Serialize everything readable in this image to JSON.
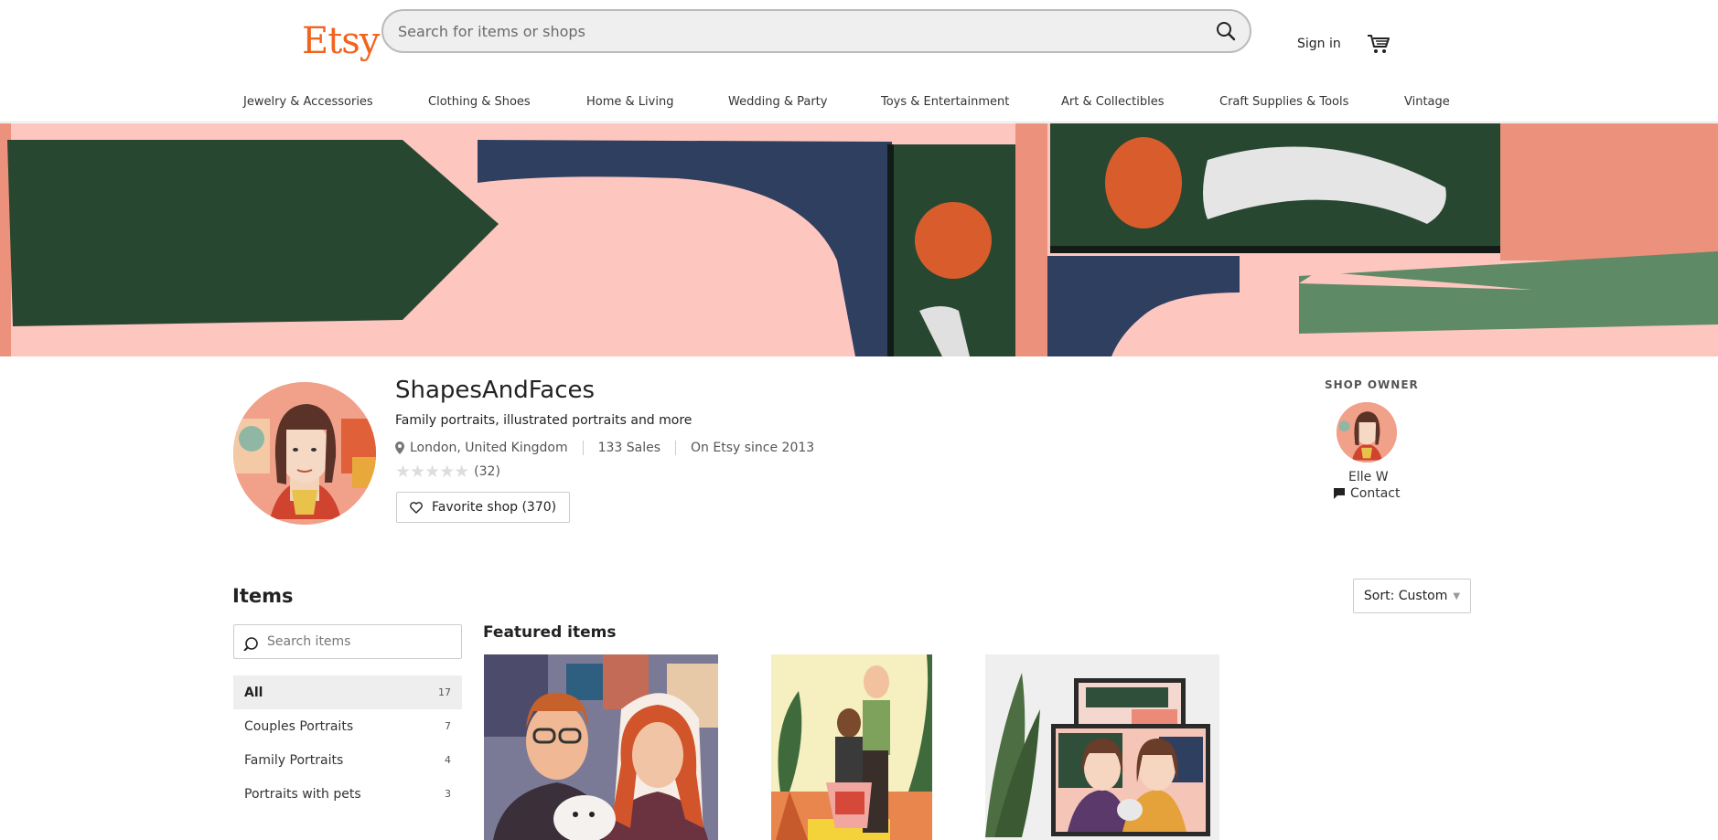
{
  "header": {
    "logo": "Etsy",
    "search_placeholder": "Search for items or shops",
    "signin_label": "Sign in",
    "categories": [
      "Jewelry & Accessories",
      "Clothing & Shoes",
      "Home & Living",
      "Wedding & Party",
      "Toys & Entertainment",
      "Art & Collectibles",
      "Craft Supplies & Tools",
      "Vintage"
    ]
  },
  "shop": {
    "name": "ShapesAndFaces",
    "tagline": "Family portraits, illustrated portraits and more",
    "location": "London, United Kingdom",
    "sales": "133 Sales",
    "since": "On Etsy since 2013",
    "stars": "★★★★★",
    "review_count": "(32)",
    "favorite_label": "Favorite shop (370)"
  },
  "owner": {
    "label": "SHOP OWNER",
    "name": "Elle W",
    "contact_label": "Contact"
  },
  "items": {
    "title": "Items",
    "sort_label": "Sort: Custom",
    "search_placeholder": "Search items",
    "sections": [
      {
        "label": "All",
        "count": "17"
      },
      {
        "label": "Couples Portraits",
        "count": "7"
      },
      {
        "label": "Family Portraits",
        "count": "4"
      },
      {
        "label": "Portraits with pets",
        "count": "3"
      }
    ],
    "featured_title": "Featured items"
  },
  "colors": {
    "brand": "#f1641e",
    "banner_pink": "#fdc7c0",
    "banner_salmon": "#ec917b",
    "banner_green": "#284731",
    "banner_navy": "#2f3f5f",
    "banner_orange": "#d95d2c",
    "banner_sage": "#5f8a66"
  }
}
